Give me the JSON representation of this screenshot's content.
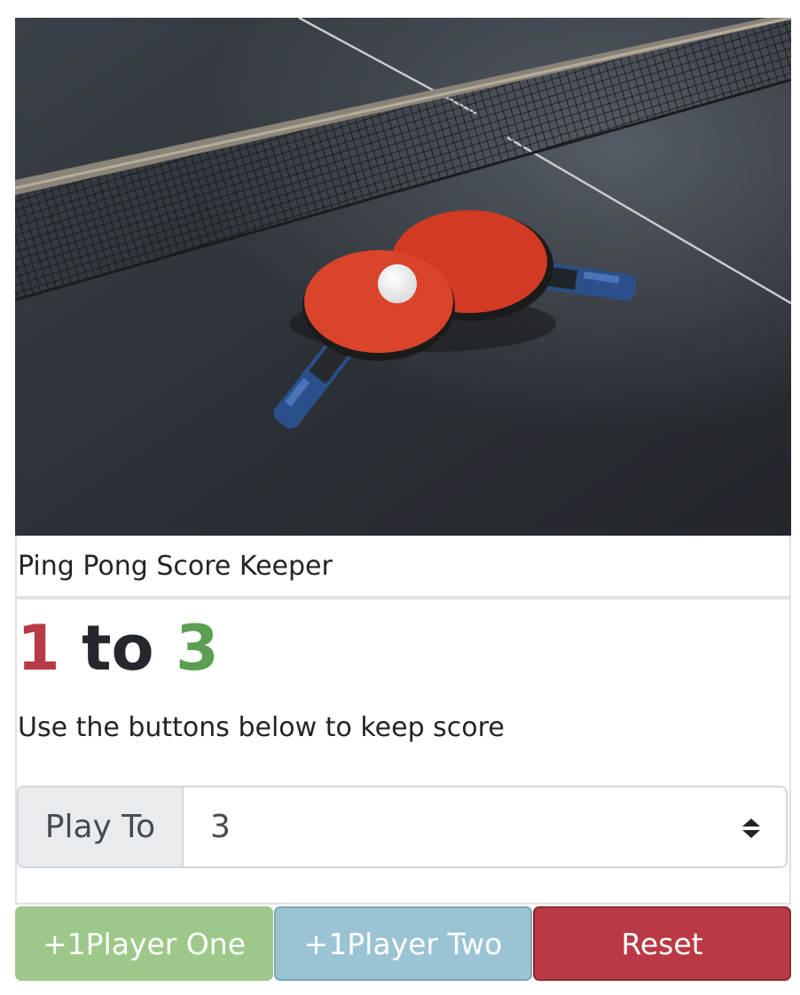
{
  "header": {
    "title": "Ping Pong Score Keeper"
  },
  "scoreboard": {
    "player_one_score": "1",
    "separator": "to",
    "player_two_score": "3"
  },
  "instructions": "Use the buttons below to keep score",
  "play_to": {
    "label": "Play To",
    "selected_value": "3"
  },
  "buttons": {
    "player_one": "+1Player One",
    "player_two": "+1Player Two",
    "reset": "Reset"
  },
  "colors": {
    "player_one": "#b93a44",
    "player_two": "#5aa050",
    "button_one_bg": "#9dc88a",
    "button_two_bg": "#9ac4d4",
    "reset_bg": "#b93a44"
  },
  "image": {
    "subject": "ping-pong paddles and ball on table"
  }
}
